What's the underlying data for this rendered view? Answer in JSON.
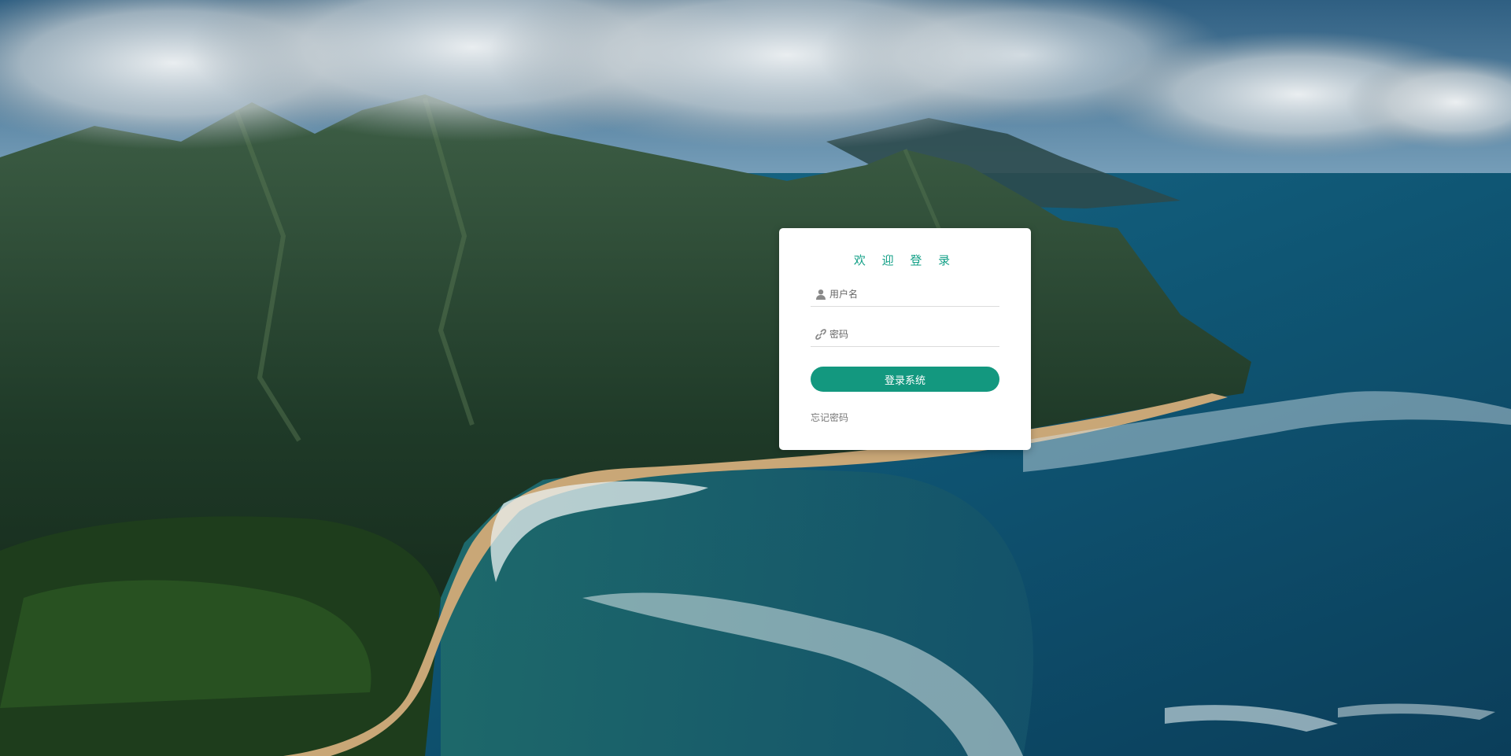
{
  "colors": {
    "accent": "#13987f",
    "title": "#13a087",
    "card_bg": "#ffffff",
    "link": "#777777"
  },
  "login": {
    "title": "欢 迎 登 录",
    "username": {
      "icon": "user-icon",
      "placeholder": "用户名",
      "value": ""
    },
    "password": {
      "icon": "link-icon",
      "placeholder": "密码",
      "value": ""
    },
    "submit_label": "登录系统",
    "forgot_label": "忘记密码"
  }
}
